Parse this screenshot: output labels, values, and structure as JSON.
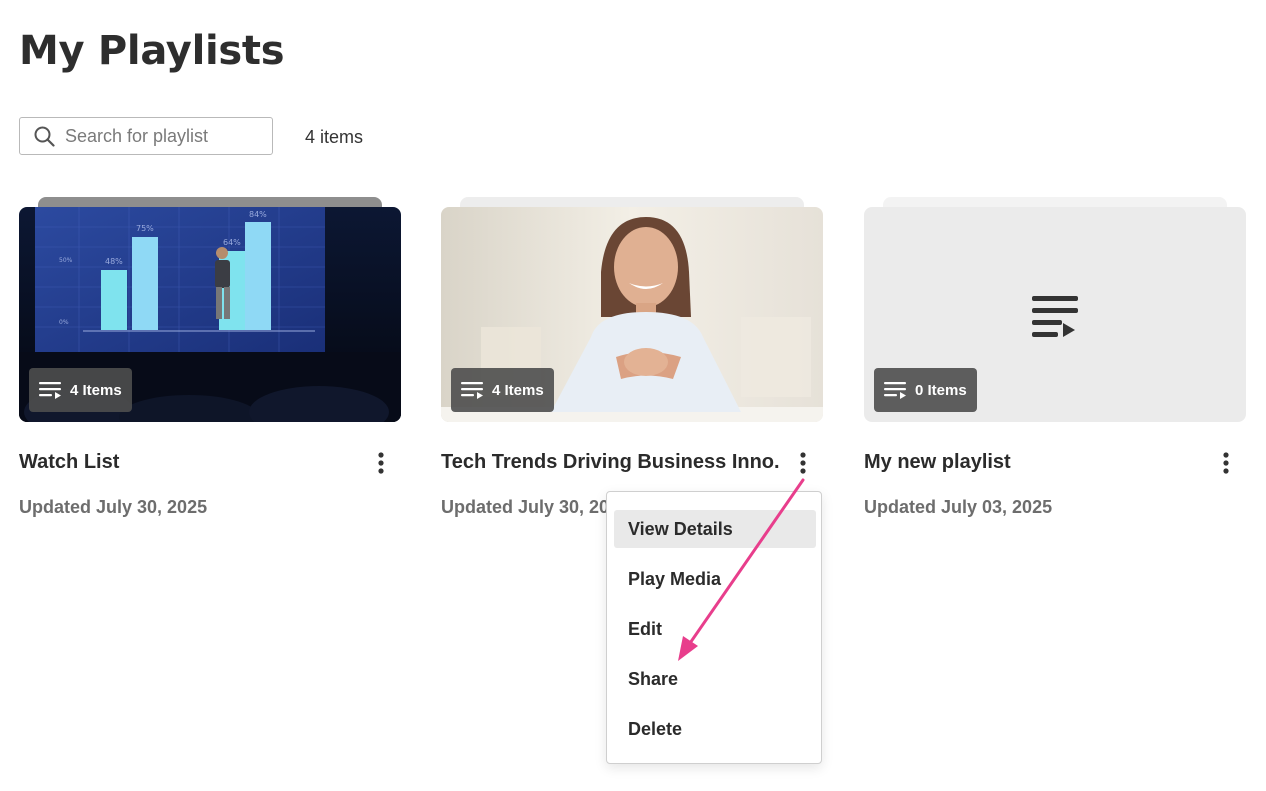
{
  "page_title": "My Playlists",
  "search": {
    "placeholder": "Search for playlist",
    "value": ""
  },
  "item_count": "4 items",
  "colors": {
    "annotation_arrow": "#e83e8c",
    "menu_highlight": "#e9e9e9",
    "badge_bg": "#4e4e4e"
  },
  "playlists": [
    {
      "title": "Watch List",
      "updated": "Updated July 30, 2025",
      "badge": "4 Items",
      "thumbnail": "presentation-stage-photo"
    },
    {
      "title": "Tech Trends Driving Business Inno...",
      "updated": "Updated July 30, 2025",
      "badge": "4 Items",
      "thumbnail": "smiling-woman-photo"
    },
    {
      "title": "My new playlist",
      "updated": "Updated July 03, 2025",
      "badge": "0 Items",
      "thumbnail": "playlist-placeholder-icon"
    }
  ],
  "context_menu": {
    "items": [
      "View Details",
      "Play Media",
      "Edit",
      "Share",
      "Delete"
    ],
    "highlighted": "View Details"
  },
  "thumb1_chart": {
    "bars": [
      "48%",
      "75%",
      "64%",
      "84%"
    ],
    "axis_ticks": [
      "50%",
      "0%"
    ]
  }
}
